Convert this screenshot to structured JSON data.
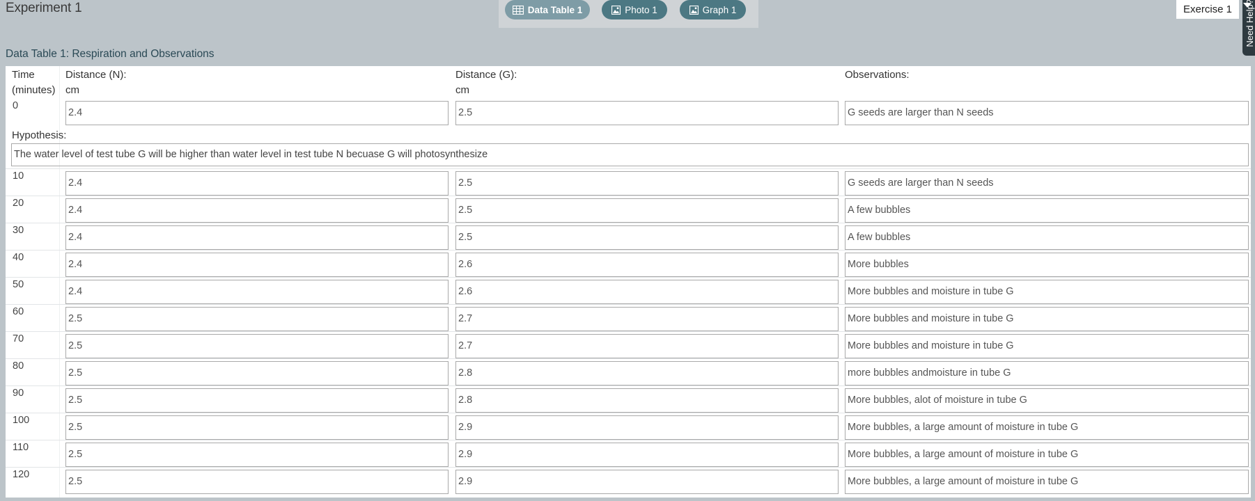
{
  "header": {
    "title": "Experiment 1",
    "tabs": [
      {
        "label": "Data Table 1",
        "icon": "table-icon",
        "active": true
      },
      {
        "label": "Photo 1",
        "icon": "image-icon",
        "active": false
      },
      {
        "label": "Graph 1",
        "icon": "image-icon",
        "active": false
      }
    ],
    "exercise": "Exercise 1",
    "help_label": "Need Help?"
  },
  "table": {
    "title": "Data Table 1: Respiration and Observations",
    "columns": {
      "time": [
        "Time",
        "(minutes)"
      ],
      "distance_n": [
        "Distance (N):",
        "cm"
      ],
      "distance_g": [
        "Distance (G):",
        "cm"
      ],
      "observations": [
        "Observations:"
      ]
    },
    "hypothesis_label": "Hypothesis:",
    "hypothesis_value": "The water level of test tube G will be higher than water level in test tube N becuase G will photosynthesize",
    "first_row": {
      "time": "0",
      "n": "2.4",
      "g": "2.5",
      "obs": "G seeds are larger than N seeds"
    },
    "rows": [
      {
        "time": "10",
        "n": "2.4",
        "g": "2.5",
        "obs": "G seeds are larger than N seeds"
      },
      {
        "time": "20",
        "n": "2.4",
        "g": "2.5",
        "obs": "A few bubbles"
      },
      {
        "time": "30",
        "n": "2.4",
        "g": "2.5",
        "obs": "A few bubbles"
      },
      {
        "time": "40",
        "n": "2.4",
        "g": "2.6",
        "obs": "More bubbles"
      },
      {
        "time": "50",
        "n": "2.4",
        "g": "2.6",
        "obs": "More bubbles and moisture in tube G"
      },
      {
        "time": "60",
        "n": "2.5",
        "g": "2.7",
        "obs": "More bubbles and moisture in tube G"
      },
      {
        "time": "70",
        "n": "2.5",
        "g": "2.7",
        "obs": "More bubbles and moisture in tube G"
      },
      {
        "time": "80",
        "n": "2.5",
        "g": "2.8",
        "obs": "more bubbles andmoisture in tube G"
      },
      {
        "time": "90",
        "n": "2.5",
        "g": "2.8",
        "obs": "More bubbles, alot of moisture in tube G"
      },
      {
        "time": "100",
        "n": "2.5",
        "g": "2.9",
        "obs": "More bubbles, a large amount of moisture in tube G"
      },
      {
        "time": "110",
        "n": "2.5",
        "g": "2.9",
        "obs": "More bubbles, a large amount of moisture in tube G"
      },
      {
        "time": "120",
        "n": "2.5",
        "g": "2.9",
        "obs": "More bubbles, a large amount of moisture in tube G"
      }
    ]
  },
  "colors": {
    "background": "#bcc4c9",
    "tab_active": "#7e9ca6",
    "tab_inactive": "#4c7883",
    "title_text": "#2a4955"
  }
}
